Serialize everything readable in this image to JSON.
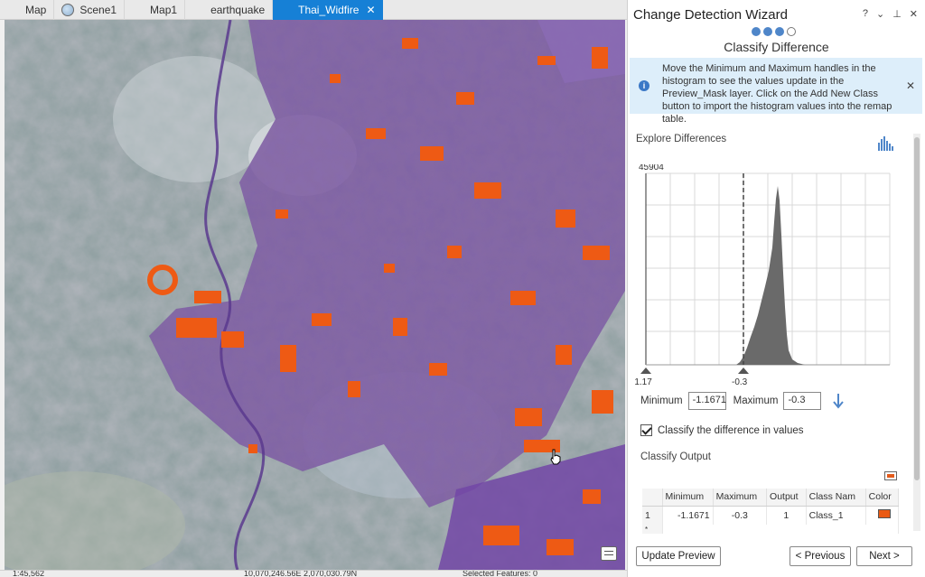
{
  "tabs": [
    {
      "label": "Map",
      "icon": "map-icon"
    },
    {
      "label": "Scene1",
      "icon": "globe-icon"
    },
    {
      "label": "Map1",
      "icon": "map-icon"
    },
    {
      "label": "earthquake",
      "icon": "map-icon"
    },
    {
      "label": "Thai_Widfire",
      "icon": "map-icon",
      "active": true
    }
  ],
  "status": {
    "scale": "1:45,562",
    "coords": "10,070,246.56E 2,070,030.79N",
    "selected": "Selected Features: 0"
  },
  "wizard": {
    "title": "Change Detection Wizard",
    "controls": [
      "?",
      "⌄",
      "⊥",
      "✕"
    ],
    "step_title": "Classify Difference",
    "steps": {
      "current": 3,
      "total": 4
    },
    "info_text": "Move the Minimum and Maximum handles in the histogram to see the values update in the Preview_Mask layer. Click on the Add New Class button to import the histogram values into the remap table.",
    "explore_title": "Explore Differences",
    "hist_max_label": "45904",
    "hist_min_tick": "-1.17",
    "hist_max_tick": "-0.3",
    "minimum_label": "Minimum",
    "minimum_value": "-1.1671",
    "maximum_label": "Maximum",
    "maximum_value": "-0.3",
    "classify_checkbox_label": "Classify the difference in values",
    "classify_output_title": "Classify Output",
    "table": {
      "headers": [
        "",
        "Minimum",
        "Maximum",
        "Output",
        "Class Nam",
        "Color"
      ],
      "rows": [
        {
          "index": "1",
          "minimum": "-1.1671",
          "maximum": "-0.3",
          "output": "1",
          "class_name": "Class_1",
          "color": "#ea5a13"
        }
      ]
    },
    "buttons": {
      "update_preview": "Update Preview",
      "previous": "< Previous",
      "next": "Next >"
    }
  }
}
